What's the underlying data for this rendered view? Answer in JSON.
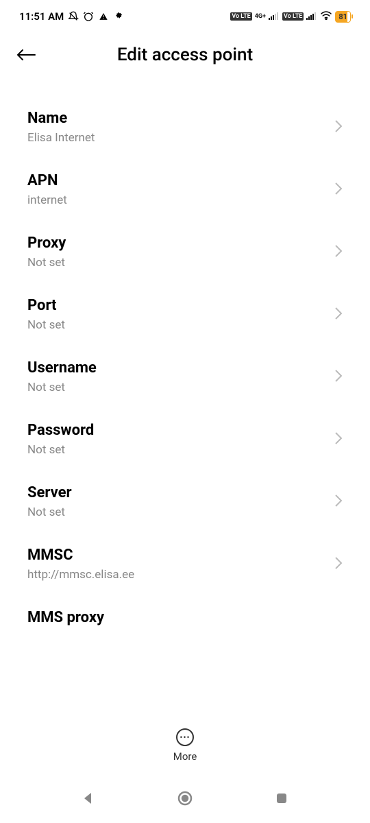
{
  "status": {
    "time": "11:51 AM",
    "network_badge1": "Vo LTE",
    "network_text": "4G+",
    "network_badge2": "Vo LTE",
    "battery": "81"
  },
  "header": {
    "title": "Edit access point"
  },
  "settings": [
    {
      "label": "Name",
      "value": "Elisa Internet"
    },
    {
      "label": "APN",
      "value": "internet"
    },
    {
      "label": "Proxy",
      "value": "Not set"
    },
    {
      "label": "Port",
      "value": "Not set"
    },
    {
      "label": "Username",
      "value": "Not set"
    },
    {
      "label": "Password",
      "value": "Not set"
    },
    {
      "label": "Server",
      "value": "Not set"
    },
    {
      "label": "MMSC",
      "value": "http://mmsc.elisa.ee"
    },
    {
      "label": "MMS proxy",
      "value": ""
    }
  ],
  "actions": {
    "more": "More"
  }
}
